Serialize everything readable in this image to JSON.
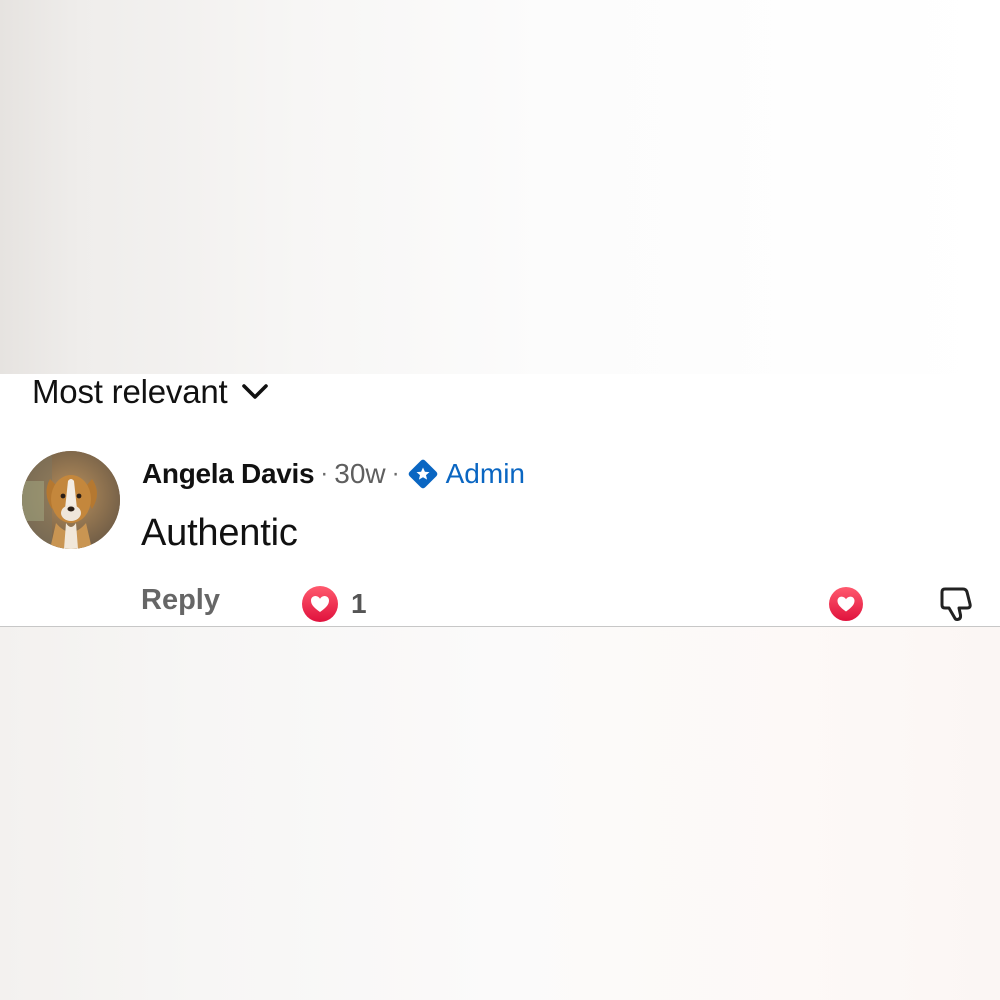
{
  "sort": {
    "label": "Most relevant",
    "icon": "chevron-down-icon"
  },
  "comment": {
    "author": "Angela Davis",
    "separator": "·",
    "time": "30w",
    "badge_icon": "admin-badge-icon",
    "badge_label": "Admin",
    "text": "Authentic",
    "reply_label": "Reply",
    "reaction_icon": "heart-icon",
    "reaction_count": "1",
    "love_button_icon": "heart-icon",
    "dislike_button_icon": "thumbs-down-icon"
  },
  "colors": {
    "accent_blue": "#0a66c2",
    "heart_red": "#f0284a",
    "text_primary": "#111111",
    "text_secondary": "#666666"
  }
}
